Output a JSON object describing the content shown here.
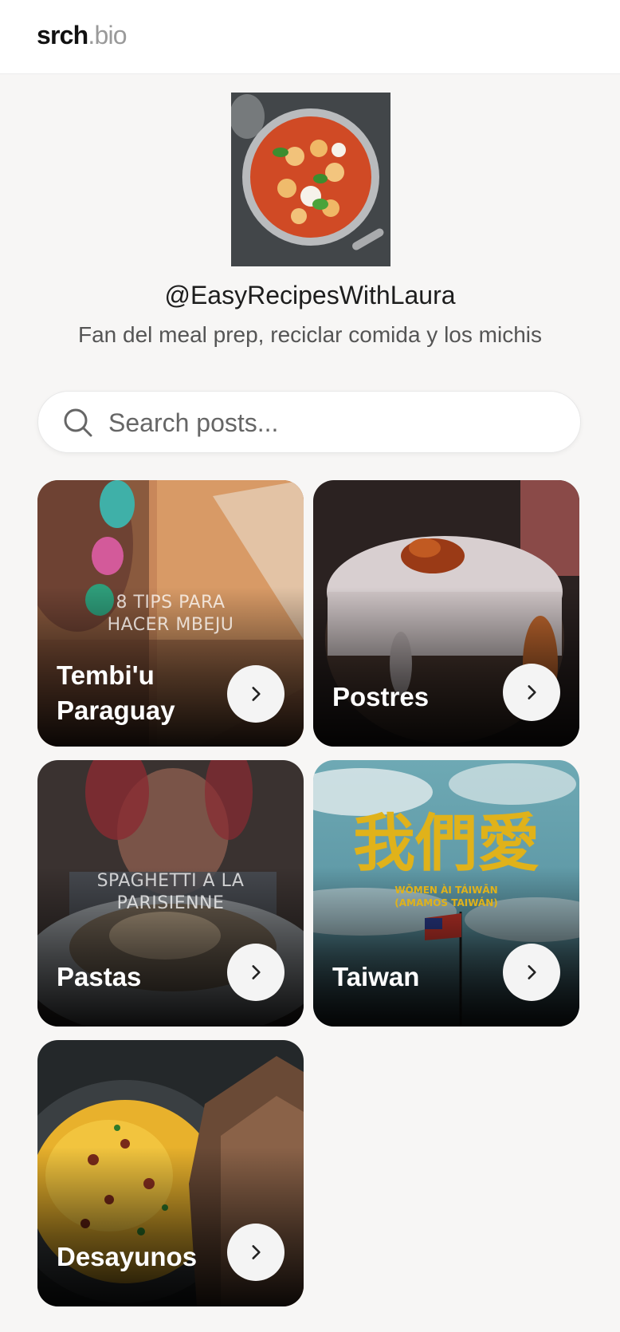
{
  "header": {
    "logo_main": "srch",
    "logo_tld": ".bio"
  },
  "profile": {
    "username": "@EasyRecipesWithLaura",
    "bio": "Fan del meal prep, reciclar comida y los michis"
  },
  "search": {
    "placeholder": "Search posts...",
    "value": ""
  },
  "categories": [
    {
      "title": "Tembi'u Paraguay",
      "overlay": "8 TIPS PARA HACER MBEJU"
    },
    {
      "title": "Postres",
      "overlay": ""
    },
    {
      "title": "Pastas",
      "overlay": "SPAGHETTI A LA PARISIENNE"
    },
    {
      "title": "Taiwan",
      "overlay_cjk": "我們愛",
      "overlay_sub1": "WǑMEN ÀI TÁIWĀN",
      "overlay_sub2": "(AMAMOS TAIWÁN)"
    },
    {
      "title": "Desayunos",
      "overlay": ""
    }
  ],
  "icons": {
    "search": "search-icon",
    "arrow": "chevron-right-icon"
  },
  "colors": {
    "background": "#f7f6f5",
    "accent_cjk": "#e0b21a",
    "button": "#f4f4f4"
  }
}
